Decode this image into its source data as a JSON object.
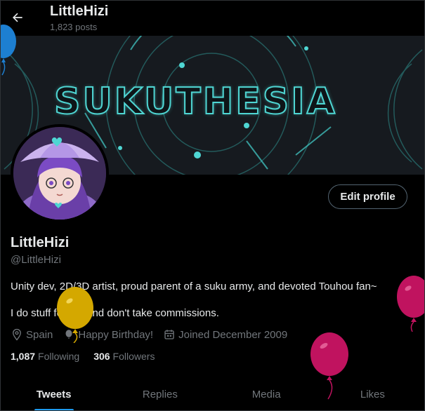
{
  "header": {
    "title": "LittleHizi",
    "posts": "1,823 posts"
  },
  "banner": {
    "text": "SUKUTHESIA"
  },
  "profile": {
    "edit_label": "Edit profile",
    "name": "LittleHizi",
    "handle": "@LittleHizi",
    "bio_line1": "Unity dev, 2D/3D artist, proud parent of a suku army, and devoted Touhou fan~",
    "bio_line2": "I do stuff for fun and don't take commissions.",
    "location": "Spain",
    "birthday": "Happy Birthday!",
    "joined": "Joined December 2009",
    "following_count": "1,087",
    "following_label": "Following",
    "followers_count": "306",
    "followers_label": "Followers"
  },
  "tabs": [
    {
      "label": "Tweets"
    },
    {
      "label": "Replies"
    },
    {
      "label": "Media"
    },
    {
      "label": "Likes"
    }
  ],
  "colors": {
    "accent": "#1d9bf0",
    "banner_glow": "#4fd6d3",
    "balloon_yellow": "#d4a800",
    "balloon_magenta": "#c0135f",
    "balloon_blue": "#1d7fd1"
  }
}
